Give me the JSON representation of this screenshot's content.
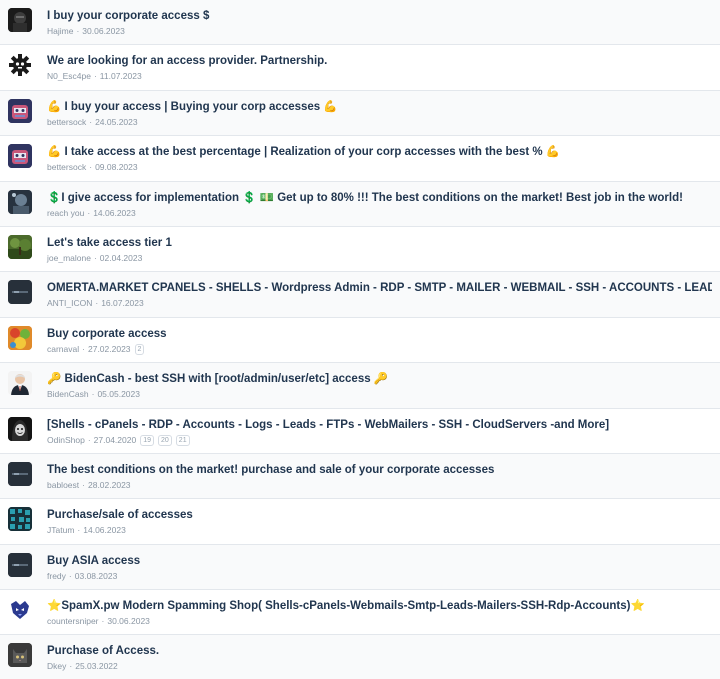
{
  "threads": [
    {
      "title": "I buy your corporate access $",
      "author": "Hajime",
      "date": "30.06.2023",
      "pages": [],
      "avatar_icon": "dark-gamer-avatar-icon",
      "avatar_bg": "#2a2a2a"
    },
    {
      "title": "We are looking for an access provider. Partnership.",
      "author": "N0_Esc4pe",
      "date": "11.07.2023",
      "pages": [],
      "avatar_icon": "gear-skull-avatar-icon",
      "avatar_bg": "#ffffff"
    },
    {
      "title": "💪 I buy your access | Buying your corp accesses 💪",
      "author": "bettersock",
      "date": "24.05.2023",
      "pages": [],
      "avatar_icon": "pink-robot-avatar-icon",
      "avatar_bg": "#3b3f6b"
    },
    {
      "title": "💪 I take access at the best percentage | Realization of your corp accesses with the best % 💪",
      "author": "bettersock",
      "date": "09.08.2023",
      "pages": [],
      "avatar_icon": "pink-robot-avatar-icon",
      "avatar_bg": "#3b3f6b"
    },
    {
      "title": "💲I give access for implementation 💲 💵 Get up to 80% !!! The best conditions on the market! Best job in the world!",
      "author": "reach you",
      "date": "14.06.2023",
      "pages": [],
      "avatar_icon": "night-portrait-avatar-icon",
      "avatar_bg": "#3a4a5c"
    },
    {
      "title": "Let's take access tier 1",
      "author": "joe_malone",
      "date": "02.04.2023",
      "pages": [],
      "avatar_icon": "forest-avatar-icon",
      "avatar_bg": "#4d6b2e"
    },
    {
      "title": "OMERTA.MARKET CPANELS - SHELLS - Wordpress Admin - RDP - SMTP - MAILER - WEBMAIL - SSH - ACCOUNTS - LEADS - ..etc",
      "author": "ANTI_ICON",
      "date": "16.07.2023",
      "pages": [],
      "avatar_icon": "dark-logo-avatar-icon",
      "avatar_bg": "#2b323b"
    },
    {
      "title": "Buy corporate access",
      "author": "carnaval",
      "date": "27.02.2023",
      "pages": [
        "2"
      ],
      "avatar_icon": "colorful-avatar-icon",
      "avatar_bg": "#d9842b"
    },
    {
      "title": "🔑 BidenCash - best SSH with [root/admin/user/etc] access 🔑",
      "author": "BidenCash",
      "date": "05.05.2023",
      "pages": [],
      "avatar_icon": "suit-man-avatar-icon",
      "avatar_bg": "#f2f2f2"
    },
    {
      "title": "[Shells - cPanels - RDP - Accounts - Logs - Leads - FTPs - WebMailers - SSH - CloudServers -and More]",
      "author": "OdinShop",
      "date": "27.04.2020",
      "pages": [
        "19",
        "20",
        "21"
      ],
      "avatar_icon": "hooded-mask-avatar-icon",
      "avatar_bg": "#1e1e1e"
    },
    {
      "title": "The best conditions on the market! purchase and sale of your corporate accesses",
      "author": "babloest",
      "date": "28.02.2023",
      "pages": [],
      "avatar_icon": "dark-logo-avatar-icon",
      "avatar_bg": "#2b323b"
    },
    {
      "title": "Purchase/sale of accesses",
      "author": "JTatum",
      "date": "14.06.2023",
      "pages": [],
      "avatar_icon": "teal-pattern-avatar-icon",
      "avatar_bg": "#1d3a44"
    },
    {
      "title": "Buy ASIA access",
      "author": "fredy",
      "date": "03.08.2023",
      "pages": [],
      "avatar_icon": "dark-logo-avatar-icon",
      "avatar_bg": "#2b323b"
    },
    {
      "title": "⭐SpamX.pw Modern Spamming Shop( Shells-cPanels-Webmails-Smtp-Leads-Mailers-SSH-Rdp-Accounts)⭐",
      "author": "countersniper",
      "date": "30.06.2023",
      "pages": [],
      "avatar_icon": "wolf-avatar-icon",
      "avatar_bg": "#ffffff"
    },
    {
      "title": "Purchase of Access.",
      "author": "Dkey",
      "date": "25.03.2022",
      "pages": [],
      "avatar_icon": "cat-avatar-icon",
      "avatar_bg": "#2c2c2c"
    }
  ],
  "meta_separator": "·",
  "colors": {
    "title": "#21364f",
    "meta": "#8a96a3",
    "row_border": "#e3e7ec"
  }
}
